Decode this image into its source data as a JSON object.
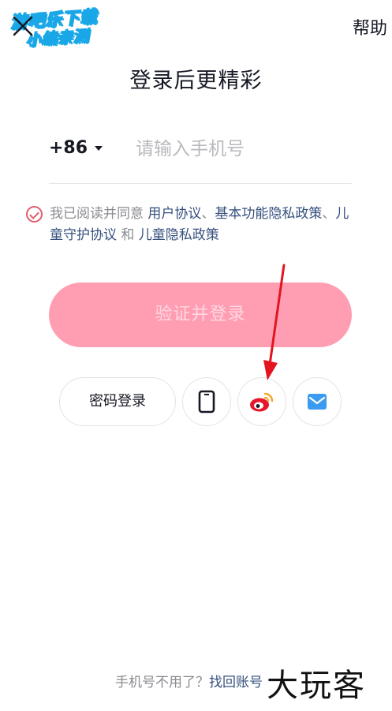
{
  "watermark": {
    "line1": "游吧乐下载",
    "line2": "小编亲测",
    "bottom": "大玩客"
  },
  "header": {
    "help_label": "帮助"
  },
  "title": "登录后更精彩",
  "phone": {
    "country_code": "+86",
    "placeholder": "请输入手机号",
    "value": ""
  },
  "agreement": {
    "prefix": "我已阅读并同意 ",
    "link1": "用户协议",
    "sep1": "、",
    "link2": "基本功能隐私政策",
    "sep2": "、",
    "link3": "儿童守护协议",
    "and": " 和 ",
    "link4": "儿童隐私政策"
  },
  "submit_label": "验证并登录",
  "alt_login": {
    "password_label": "密码登录"
  },
  "footer": {
    "question": "手机号不用了？",
    "link": "找回账号"
  },
  "colors": {
    "primary_disabled": "#ff9eb3",
    "link": "#35507d",
    "check": "#e05e6f",
    "weibo": "#e6162d",
    "email": "#3a9bf0"
  }
}
